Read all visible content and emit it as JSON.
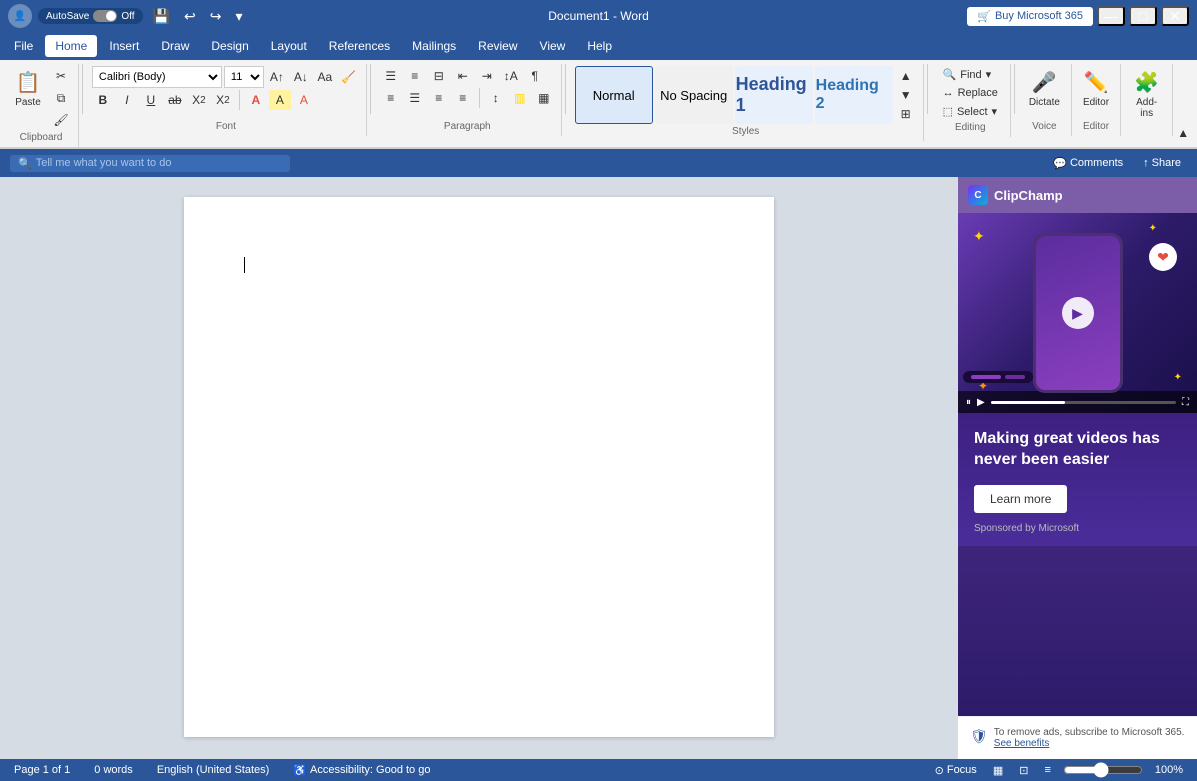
{
  "titleBar": {
    "appName": "Word",
    "docName": "Document1",
    "separator": " - ",
    "autoSaveLabel": "AutoSave",
    "autoSaveState": "Off",
    "minimize": "—",
    "maximize": "□",
    "close": "✕",
    "buyBtn": "Buy Microsoft 365",
    "undoTitle": "Undo",
    "redoTitle": "Redo",
    "moreTitle": "Customize Quick Access Toolbar"
  },
  "menuBar": {
    "items": [
      "File",
      "Home",
      "Insert",
      "Draw",
      "Design",
      "Layout",
      "References",
      "Mailings",
      "Review",
      "View",
      "Help"
    ]
  },
  "searchBar": {
    "placeholder": "Tell me what you want to do",
    "commentsLabel": "Comments",
    "shareLabel": "Share"
  },
  "ribbon": {
    "groups": {
      "clipboard": {
        "label": "Clipboard",
        "pasteLabel": "Paste"
      },
      "font": {
        "label": "Font",
        "fontName": "Calibri (Body)",
        "fontSize": "11",
        "bold": "B",
        "italic": "I",
        "underline": "U",
        "strikethrough": "ab",
        "subscript": "X₂",
        "superscript": "X²"
      },
      "paragraph": {
        "label": "Paragraph"
      },
      "styles": {
        "label": "Styles",
        "normal": "Normal",
        "noSpacing": "No Spacing",
        "heading1": "Heading 1",
        "heading2": "Heading 2"
      },
      "editing": {
        "label": "Editing",
        "find": "Find",
        "replace": "Replace",
        "select": "Select"
      },
      "voice": {
        "label": "Voice",
        "dictate": "Dictate"
      },
      "editor": {
        "label": "Editor",
        "editor": "Editor"
      },
      "addins": {
        "label": "Add-ins"
      }
    }
  },
  "document": {
    "content": ""
  },
  "sidebar": {
    "title": "ClipChamp",
    "promoHeading": "Making great videos has",
    "promoHeading2": "never been easier",
    "learnMoreLabel": "Learn more",
    "sponsoredText": "Sponsored by Microsoft",
    "footerText": "To remove ads, subscribe to Microsoft 365.",
    "seeBenefitsLabel": "See benefits"
  },
  "statusBar": {
    "page": "Page 1 of 1",
    "words": "0 words",
    "language": "English (United States)",
    "accessibility": "Accessibility: Good to go",
    "focusLabel": "Focus",
    "zoomLevel": "100%"
  }
}
